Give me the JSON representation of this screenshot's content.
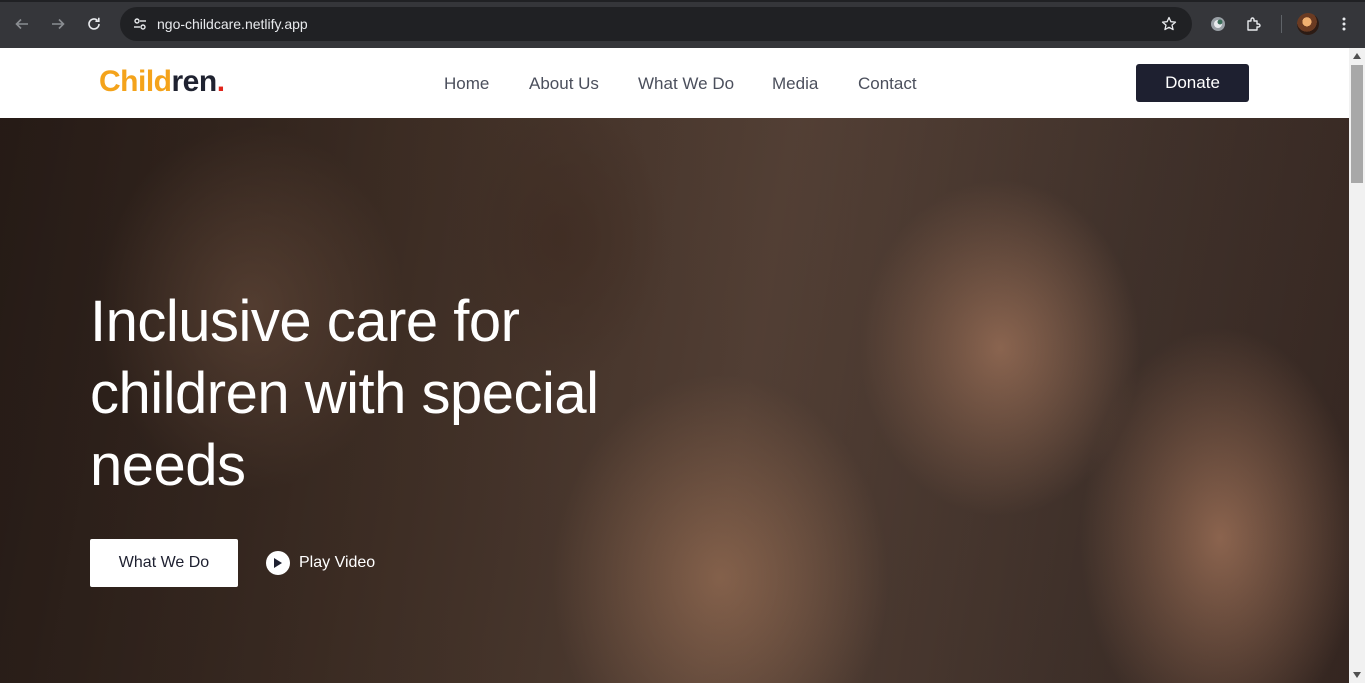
{
  "browser": {
    "url": "ngo-childcare.netlify.app",
    "icons": {
      "back": "arrow-left-icon",
      "forward": "arrow-right-icon",
      "reload": "reload-icon",
      "site_info": "tune-icon",
      "bookmark": "star-icon",
      "extension_a": "extension-globe-icon",
      "extensions": "puzzle-icon",
      "menu": "kebab-menu-icon"
    }
  },
  "header": {
    "logo": {
      "part1": "Child",
      "part2": "ren",
      "part3": "."
    },
    "nav": [
      {
        "label": "Home"
      },
      {
        "label": "About Us"
      },
      {
        "label": "What We Do"
      },
      {
        "label": "Media"
      },
      {
        "label": "Contact"
      }
    ],
    "donate_label": "Donate"
  },
  "hero": {
    "title": "Inclusive care for children with special needs",
    "primary_button": "What We Do",
    "video_link": "Play Video"
  },
  "colors": {
    "logo_orange": "#f4a31b",
    "logo_dark": "#1f2230",
    "logo_dot_red": "#e1251b",
    "donate_bg": "#1e2030"
  }
}
